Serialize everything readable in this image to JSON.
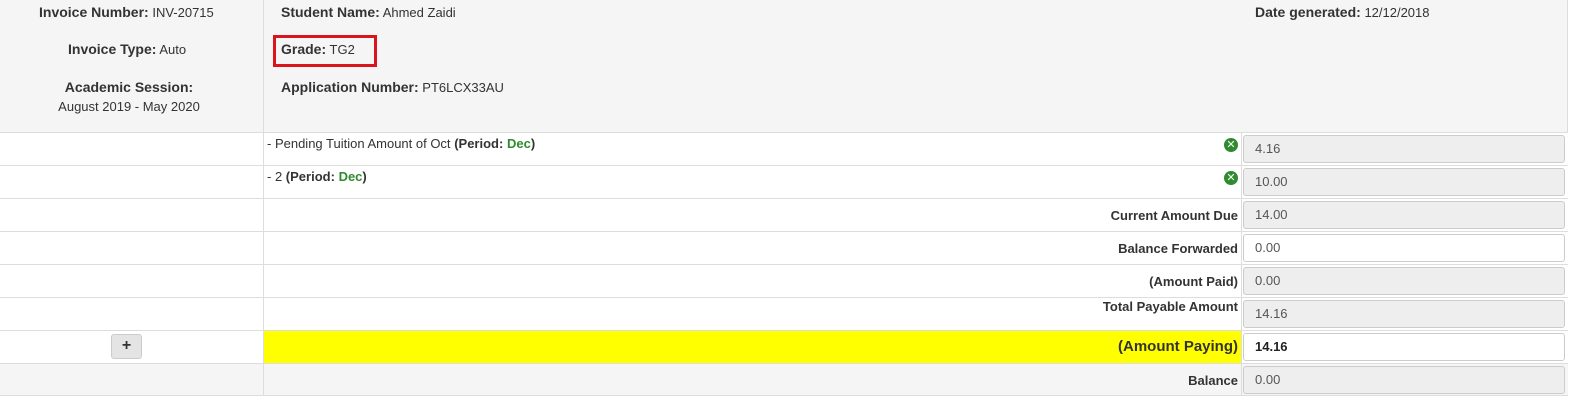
{
  "header": {
    "invoice_number": {
      "label": "Invoice Number:",
      "value": "INV-20715"
    },
    "invoice_type": {
      "label": "Invoice Type:",
      "value": "Auto"
    },
    "academic_session": {
      "label": "Academic Session:",
      "value": "August 2019 - May 2020"
    },
    "student_name": {
      "label": "Student Name:",
      "value": "Ahmed Zaidi"
    },
    "grade": {
      "label": "Grade:",
      "value": "TG2"
    },
    "application_number": {
      "label": "Application Number:",
      "value": "PT6LCX33AU"
    },
    "date_generated": {
      "label": "Date generated:",
      "value": "12/12/2018"
    }
  },
  "items": [
    {
      "desc": "- Pending Tuition Amount of Oct",
      "period_label": "Period:",
      "period_value": "Dec",
      "amount": "4.16"
    },
    {
      "desc": "- 2",
      "period_label": "Period:",
      "period_value": "Dec",
      "amount": "10.00"
    }
  ],
  "summary": {
    "current_amount_due": {
      "label": "Current Amount Due",
      "value": "14.00"
    },
    "balance_forwarded": {
      "label": "Balance Forwarded",
      "value": "0.00"
    },
    "amount_paid": {
      "label": "(Amount Paid)",
      "value": "0.00"
    },
    "total_payable": {
      "label": "Total Payable Amount",
      "value": "14.16"
    },
    "amount_paying": {
      "label": "(Amount Paying)",
      "value": "14.16"
    },
    "balance": {
      "label": "Balance",
      "value": "0.00"
    }
  },
  "buttons": {
    "add": "+",
    "remove": "✕"
  },
  "colors": {
    "highlight": "#ffff00",
    "period_green": "#2e8b2e",
    "grade_box": "#d9141d"
  }
}
